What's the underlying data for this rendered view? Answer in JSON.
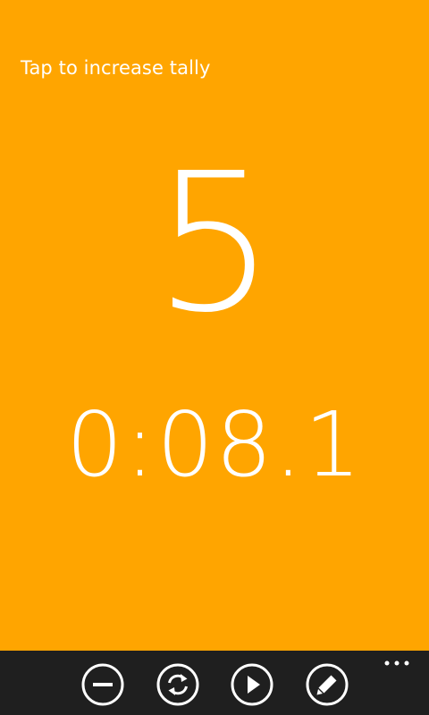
{
  "hint": "Tap to increase tally",
  "tally": "5",
  "timer": "0:08.1",
  "colors": {
    "accent": "#FFA500",
    "appbar": "#1f1f1f",
    "foreground": "#ffffff"
  },
  "appbar": {
    "buttons": [
      {
        "icon": "minus-icon"
      },
      {
        "icon": "refresh-icon"
      },
      {
        "icon": "play-icon"
      },
      {
        "icon": "edit-icon"
      }
    ],
    "more_icon": "ellipsis-icon"
  }
}
